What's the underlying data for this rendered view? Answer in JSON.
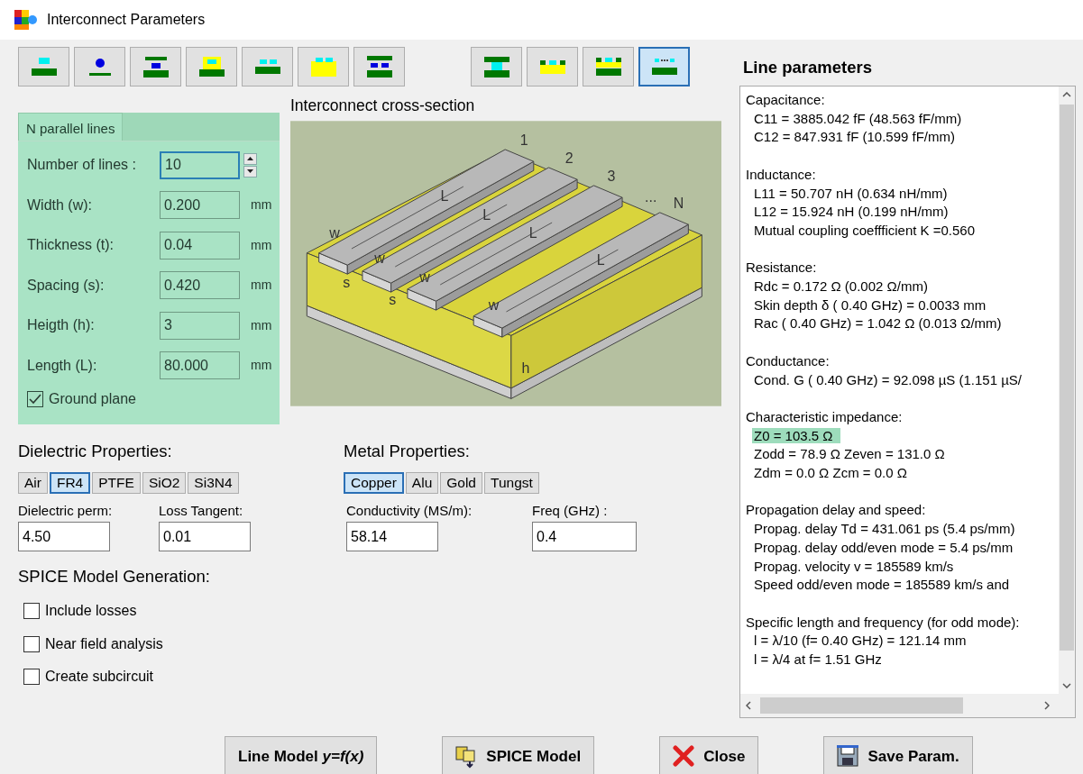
{
  "window": {
    "title": "Interconnect Parameters"
  },
  "toolbar_groups": [
    {
      "buttons": [
        {
          "selected": false
        },
        {
          "selected": false
        },
        {
          "selected": false
        },
        {
          "selected": false
        },
        {
          "selected": false
        },
        {
          "selected": false
        },
        {
          "selected": false
        }
      ]
    },
    {
      "buttons": [
        {
          "selected": false
        },
        {
          "selected": false
        },
        {
          "selected": false
        },
        {
          "selected": true
        }
      ]
    }
  ],
  "structure_panel": {
    "tab": "N parallel lines",
    "fields": [
      {
        "kind": "spin",
        "label": "Number of lines :",
        "value": "10",
        "focused": true
      },
      {
        "kind": "unit",
        "label": "Width (w):",
        "value": "0.200",
        "unit": "mm",
        "focused": false
      },
      {
        "kind": "unit",
        "label": "Thickness (t):",
        "value": "0.04",
        "unit": "mm",
        "focused": false
      },
      {
        "kind": "unit",
        "label": "Spacing (s):",
        "value": "0.420",
        "unit": "mm",
        "focused": false
      },
      {
        "kind": "unit",
        "label": "Heigth (h):",
        "value": "3",
        "unit": "mm",
        "focused": false
      },
      {
        "kind": "unit",
        "label": "Length (L):",
        "value": "80.000",
        "unit": "mm",
        "focused": false
      }
    ],
    "ground_plane": {
      "label": "Ground plane",
      "checked": true
    }
  },
  "cross_section": {
    "title": "Interconnect cross-section",
    "labels": [
      "1",
      "2",
      "3",
      "...",
      "L",
      "N",
      "L",
      "L",
      "w",
      "L",
      "w",
      "s",
      "w",
      "s",
      "w",
      "h"
    ]
  },
  "dielectric": {
    "title": "Dielectric Properties:",
    "materials": [
      {
        "label": "Air",
        "selected": false
      },
      {
        "label": "FR4",
        "selected": true
      },
      {
        "label": "PTFE",
        "selected": false
      },
      {
        "label": "SiO2",
        "selected": false
      },
      {
        "label": "Si3N4",
        "selected": false
      }
    ],
    "fields": [
      {
        "label": "Dielectric perm:",
        "value": "4.50"
      },
      {
        "label": "Loss Tangent:",
        "value": "0.01"
      }
    ]
  },
  "metal": {
    "title": "Metal Properties:",
    "materials": [
      {
        "label": "Copper",
        "selected": true
      },
      {
        "label": "Alu",
        "selected": false
      },
      {
        "label": "Gold",
        "selected": false
      },
      {
        "label": "Tungst",
        "selected": false
      }
    ],
    "fields": [
      {
        "label": "Conductivity (MS/m):",
        "value": "58.14"
      },
      {
        "label": "Freq (GHz) :",
        "value": "0.4"
      }
    ]
  },
  "spice": {
    "title": "SPICE Model Generation:",
    "options": [
      {
        "label": "Include losses",
        "checked": false
      },
      {
        "label": "Near field analysis",
        "checked": false
      },
      {
        "label": "Create subcircuit",
        "checked": false
      }
    ]
  },
  "line_parameters": {
    "title": "Line parameters",
    "sections": [
      {
        "heading": "Capacitance:",
        "lines": [
          {
            "text": "C11 = 3885.042 fF (48.563 fF/mm)",
            "highlighted": false
          },
          {
            "text": "C12 = 847.931 fF (10.599 fF/mm)",
            "highlighted": false
          }
        ]
      },
      {
        "heading": "Inductance:",
        "lines": [
          {
            "text": "L11 = 50.707 nH (0.634 nH/mm)",
            "highlighted": false
          },
          {
            "text": "L12 = 15.924 nH (0.199 nH/mm)",
            "highlighted": false
          },
          {
            "text": "Mutual coupling coeffficient K =0.560",
            "highlighted": false
          }
        ]
      },
      {
        "heading": "Resistance:",
        "lines": [
          {
            "text": "Rdc = 0.172 Ω (0.002 Ω/mm)",
            "highlighted": false
          },
          {
            "text": "Skin depth δ ( 0.40 GHz) = 0.0033 mm",
            "highlighted": false
          },
          {
            "text": "Rac ( 0.40 GHz) = 1.042 Ω (0.013 Ω/mm)",
            "highlighted": false
          }
        ]
      },
      {
        "heading": "Conductance:",
        "lines": [
          {
            "text": "Cond. G ( 0.40 GHz) = 92.098 µS (1.151 µS/",
            "highlighted": false
          }
        ]
      },
      {
        "heading": "Characteristic impedance:",
        "lines": [
          {
            "text": "Z0 = 103.5 Ω",
            "highlighted": true
          },
          {
            "text": "Zodd = 78.9 Ω  Zeven = 131.0 Ω",
            "highlighted": false
          },
          {
            "text": "Zdm = 0.0 Ω  Zcm = 0.0 Ω",
            "highlighted": false
          }
        ]
      },
      {
        "heading": "Propagation delay and speed:",
        "lines": [
          {
            "text": "Propag. delay Td = 431.061 ps (5.4 ps/mm)",
            "highlighted": false
          },
          {
            "text": "Propag. delay odd/even mode = 5.4 ps/mm",
            "highlighted": false
          },
          {
            "text": "Propag. velocity v = 185589 km/s",
            "highlighted": false
          },
          {
            "text": "Speed odd/even mode = 185589 km/s and",
            "highlighted": false
          }
        ]
      },
      {
        "heading": "Specific length and frequency (for odd mode):",
        "lines": [
          {
            "text": "l = λ/10 (f= 0.40 GHz) = 121.14 mm",
            "highlighted": false
          },
          {
            "text": "l = λ/4 at f= 1.51 GHz",
            "highlighted": false
          }
        ]
      }
    ]
  },
  "buttons": [
    {
      "kind": "line-model",
      "label": "Line Model *y=f(x)*"
    },
    {
      "kind": "spice",
      "label": "SPICE Model"
    },
    {
      "kind": "close",
      "label": "Close"
    },
    {
      "kind": "save",
      "label": "Save Param."
    }
  ]
}
